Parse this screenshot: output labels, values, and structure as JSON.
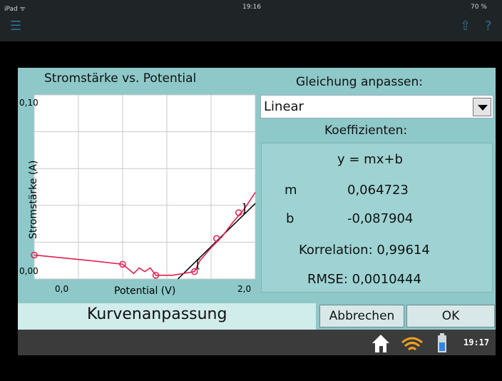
{
  "ipad": {
    "carrier": "iPad ᯤ",
    "time": "19:16",
    "battery": "70 %"
  },
  "dialog": {
    "chart_title": "Stromstärke vs. Potential",
    "fit_heading": "Gleichung anpassen:",
    "fit_selected": "Linear",
    "coeff_heading": "Koeffizienten:",
    "equation": "y = mx+b",
    "m_label": "m",
    "m_value": "0,064723",
    "b_label": "b",
    "b_value": "-0,087904",
    "correlation": "Korrelation: 0,99614",
    "rmse": "RMSE: 0,0010444",
    "footer_label": "Kurvenanpassung",
    "cancel_label": "Abbrechen",
    "ok_label": "OK"
  },
  "navbar": {
    "clock": "19:17"
  },
  "colors": {
    "dialog_bg": "#8ec8c9",
    "data_line": "#e0204f",
    "fit_line": "#000000"
  },
  "chart_data": {
    "type": "line",
    "title": "Stromstärke vs. Potential",
    "xlabel": "Potential (V)",
    "ylabel": "Stromstärke (A)",
    "xlim": [
      0.0,
      2.0
    ],
    "ylim": [
      0.0,
      0.1
    ],
    "x_ticks": [
      "0,0",
      "2,0"
    ],
    "y_ticks": [
      "0,00",
      "0,10"
    ],
    "grid": true,
    "series": [
      {
        "points": [
          [
            0.0,
            0.013
          ],
          [
            0.5,
            0.01
          ],
          [
            0.8,
            0.008
          ],
          [
            0.9,
            0.003
          ],
          [
            0.95,
            0.006
          ],
          [
            1.0,
            0.004
          ],
          [
            1.05,
            0.006
          ],
          [
            1.1,
            0.002
          ],
          [
            1.25,
            0.002
          ],
          [
            1.35,
            0.003
          ],
          [
            1.45,
            0.004
          ],
          [
            1.5,
            0.01
          ],
          [
            1.6,
            0.017
          ],
          [
            1.7,
            0.023
          ],
          [
            1.8,
            0.031
          ],
          [
            1.9,
            0.038
          ],
          [
            2.0,
            0.047
          ]
        ],
        "markers": [
          [
            0.0,
            0.013
          ],
          [
            0.8,
            0.008
          ],
          [
            1.1,
            0.002
          ],
          [
            1.45,
            0.004
          ],
          [
            1.65,
            0.022
          ],
          [
            1.85,
            0.036
          ]
        ]
      },
      {
        "fit_line": [
          [
            1.3,
            0.0
          ],
          [
            2.0,
            0.041
          ]
        ]
      }
    ]
  }
}
